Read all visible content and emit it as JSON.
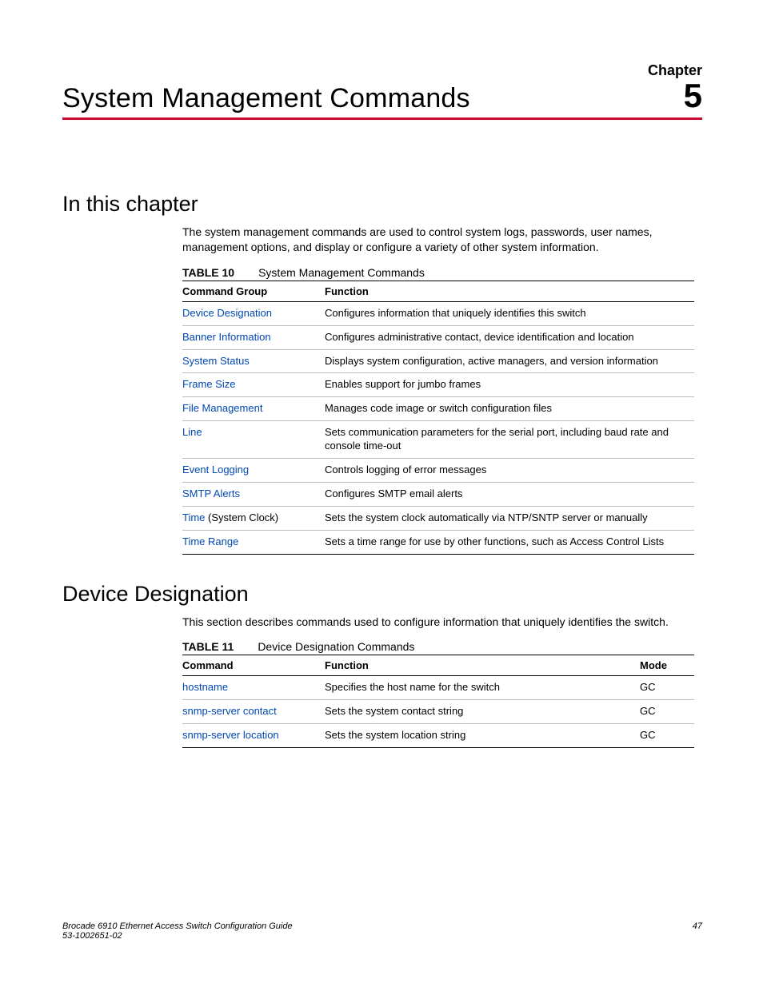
{
  "header": {
    "chapter_label": "Chapter",
    "title": "System Management Commands",
    "chapter_num": "5"
  },
  "section1": {
    "heading": "In this chapter",
    "intro": "The system management commands are used to control system logs, passwords, user names, management options, and display or configure a variety of other system information.",
    "table_label": "TABLE 10",
    "table_title": "System Management Commands",
    "headers": {
      "c1": "Command Group",
      "c2": "Function"
    },
    "rows": [
      {
        "cmd": "Device Designation",
        "suffix": "",
        "func": "Configures information that uniquely identifies this switch"
      },
      {
        "cmd": "Banner Information",
        "suffix": "",
        "func": "Configures administrative contact, device identification and location"
      },
      {
        "cmd": "System Status",
        "suffix": "",
        "func": "Displays system configuration, active managers, and version information"
      },
      {
        "cmd": "Frame Size",
        "suffix": "",
        "func": "Enables support for jumbo frames"
      },
      {
        "cmd": "File Management",
        "suffix": "",
        "func": "Manages code image or switch configuration files"
      },
      {
        "cmd": "Line",
        "suffix": "",
        "func": "Sets communication parameters for the serial port, including baud rate and console time-out"
      },
      {
        "cmd": "Event Logging",
        "suffix": "",
        "func": "Controls logging of error messages"
      },
      {
        "cmd": "SMTP Alerts",
        "suffix": "",
        "func": "Configures SMTP email alerts"
      },
      {
        "cmd": "Time",
        "suffix": " (System Clock)",
        "func": "Sets the system clock automatically via NTP/SNTP server or manually"
      },
      {
        "cmd": "Time Range",
        "suffix": "",
        "func": "Sets a time range for use by other functions, such as Access Control Lists"
      }
    ]
  },
  "section2": {
    "heading": "Device Designation",
    "intro": "This section describes commands used to configure information that uniquely identifies the switch.",
    "table_label": "TABLE 11",
    "table_title": "Device Designation Commands",
    "headers": {
      "c1": "Command",
      "c2": "Function",
      "c3": "Mode"
    },
    "rows": [
      {
        "cmd": "hostname",
        "func": "Specifies the host name for the switch",
        "mode": "GC"
      },
      {
        "cmd": "snmp-server contact",
        "func": "Sets the system contact string",
        "mode": "GC"
      },
      {
        "cmd": "snmp-server location",
        "func": "Sets the system location string",
        "mode": "GC"
      }
    ]
  },
  "footer": {
    "left1": "Brocade 6910 Ethernet Access Switch Configuration Guide",
    "left2": "53-1002651-02",
    "right": "47"
  }
}
